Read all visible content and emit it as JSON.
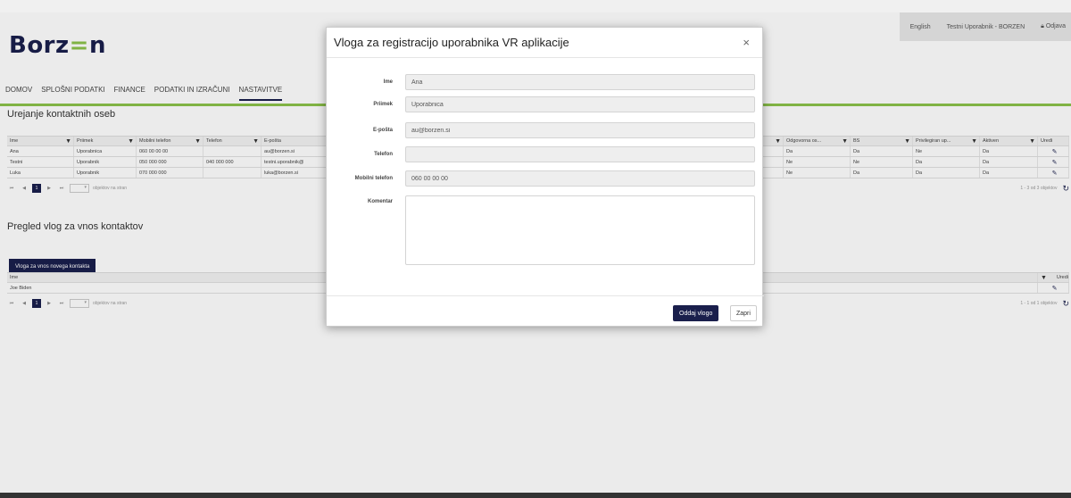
{
  "header": {
    "logo": "Borzen",
    "language": "English",
    "user": "Testni Uporabnik - BORZEN",
    "logout": "Odjava"
  },
  "nav": {
    "items": [
      "DOMOV",
      "SPLOŠNI PODATKI",
      "FINANCE",
      "PODATKI IN IZRAČUNI",
      "NASTAVITVE"
    ],
    "active": "NASTAVITVE"
  },
  "contacts": {
    "title": "Urejanje kontaktnih oseb",
    "columns": [
      "Ime",
      "Priimek",
      "Mobilni telefon",
      "Telefon",
      "E-pošta",
      "Odgovorna os...",
      "BS",
      "Privilegiran up...",
      "Aktiven",
      "Uredi"
    ],
    "rows": [
      {
        "ime": "Ana",
        "priimek": "Uporabnica",
        "mobilni": "060 00 00 00",
        "telefon": "",
        "email": "au@borzen.si",
        "odgovorna": "Da",
        "bs": "Da",
        "privilegiran": "Ne",
        "aktiven": "Da"
      },
      {
        "ime": "Testni",
        "priimek": "Uporabnik",
        "mobilni": "050 000 000",
        "telefon": "040 000 000",
        "email": "testni.uporabnik@",
        "odgovorna": "Ne",
        "bs": "Ne",
        "privilegiran": "Da",
        "aktiven": "Da"
      },
      {
        "ime": "Luka",
        "priimek": "Uporabnik",
        "mobilni": "070 000 000",
        "telefon": "",
        "email": "luka@borzen.si",
        "odgovorna": "Ne",
        "bs": "Da",
        "privilegiran": "Da",
        "aktiven": "Da"
      }
    ],
    "pager": {
      "page": "1",
      "per_page_label": "objektov na stran",
      "summary": "1 - 3 od 3 objektov"
    }
  },
  "requests": {
    "title": "Pregled vlog za vnos kontaktov",
    "new_button": "Vloga za vnos novega kontakta",
    "columns": [
      "Ime",
      "Uredi"
    ],
    "rows": [
      {
        "ime": "Joe Biden"
      }
    ],
    "pager": {
      "page": "1",
      "per_page_label": "objektov na stran",
      "summary": "1 - 1 od 1 objektov"
    }
  },
  "modal": {
    "title": "Vloga za registracijo uporabnika VR aplikacije",
    "close_icon": "×",
    "fields": [
      {
        "label": "Ime",
        "value": "Ana"
      },
      {
        "label": "Priimek",
        "value": "Uporabnica"
      },
      {
        "label": "E-pošta",
        "value": "au@borzen.si"
      },
      {
        "label": "Telefon",
        "value": ""
      },
      {
        "label": "Mobilni telefon",
        "value": "060 00 00 00"
      }
    ],
    "comment_label": "Komentar",
    "submit": "Oddaj vlogo",
    "close": "Zapri"
  },
  "colors": {
    "primary": "#1a1f4c",
    "accent": "#8bc34a"
  }
}
